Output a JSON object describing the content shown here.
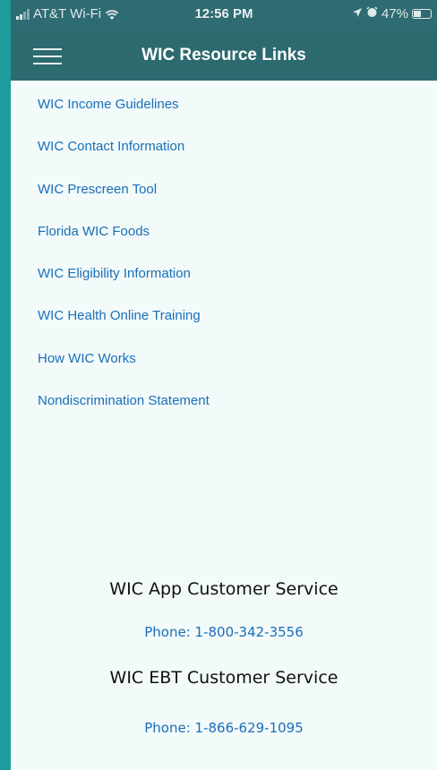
{
  "status_bar": {
    "carrier": "AT&T Wi-Fi",
    "time": "12:56 PM",
    "battery": "47%",
    "battery_level": 0.47,
    "icons": [
      "signal-icon",
      "wifi-icon",
      "location-arrow-icon",
      "alarm-icon",
      "battery-icon"
    ]
  },
  "header": {
    "title": "WIC Resource Links",
    "menu_icon": "hamburger-menu-icon"
  },
  "links": [
    "WIC Income Guidelines",
    "WIC Contact Information",
    "WIC Prescreen Tool",
    "Florida WIC Foods",
    "WIC Eligibility Information",
    "WIC Health Online Training",
    "How WIC Works",
    "Nondiscrimination Statement"
  ],
  "customer_service": {
    "app_title": "WIC App Customer Service",
    "app_phone": "Phone: 1-800-342-3556",
    "ebt_title": "WIC EBT Customer Service",
    "ebt_phone": "Phone: 1-866-629-1095"
  },
  "colors": {
    "header_bg": "#2d6a6f",
    "link": "#1a6fb8",
    "frame": "#1e9c9c",
    "page_bg": "#f2fafa"
  }
}
